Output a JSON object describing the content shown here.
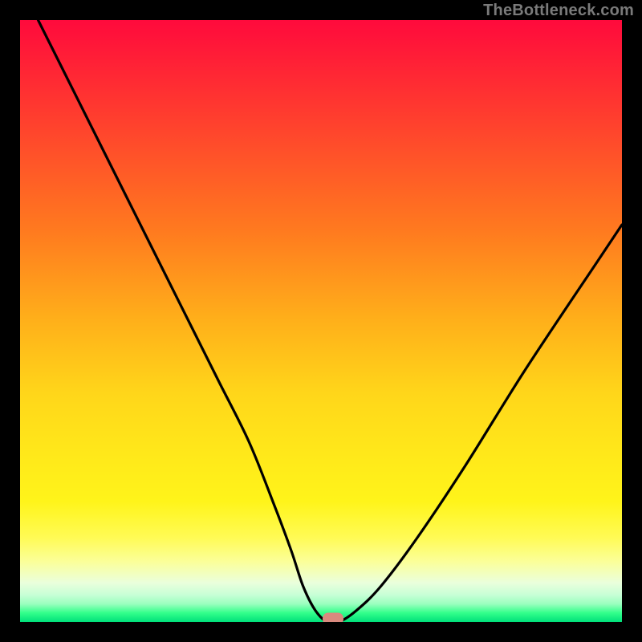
{
  "watermark": "TheBottleneck.com",
  "chart_data": {
    "type": "line",
    "title": "",
    "xlabel": "",
    "ylabel": "",
    "xlim": [
      0,
      100
    ],
    "ylim": [
      0,
      100
    ],
    "grid": false,
    "series": [
      {
        "name": "bottleneck-curve",
        "x": [
          3,
          8,
          13,
          18,
          23,
          28,
          33,
          38,
          42,
          45,
          47,
          49,
          51,
          53,
          56,
          60,
          66,
          74,
          84,
          96,
          100
        ],
        "y": [
          100,
          90,
          80,
          70,
          60,
          50,
          40,
          30,
          20,
          12,
          6,
          2,
          0,
          0,
          2,
          6,
          14,
          26,
          42,
          60,
          66
        ]
      }
    ],
    "markers": [
      {
        "name": "optimal-point",
        "x": 52,
        "y": 0.5,
        "color": "#d98a7e"
      }
    ],
    "background": {
      "type": "vertical-gradient",
      "stops": [
        {
          "pos": 0,
          "color": "#ff0a3c"
        },
        {
          "pos": 0.5,
          "color": "#ffb01a"
        },
        {
          "pos": 0.8,
          "color": "#fff41a"
        },
        {
          "pos": 1.0,
          "color": "#00e07a"
        }
      ]
    }
  },
  "colors": {
    "frame": "#000000",
    "curve": "#000000",
    "marker": "#d98a7e",
    "watermark": "#7a7a7a"
  }
}
